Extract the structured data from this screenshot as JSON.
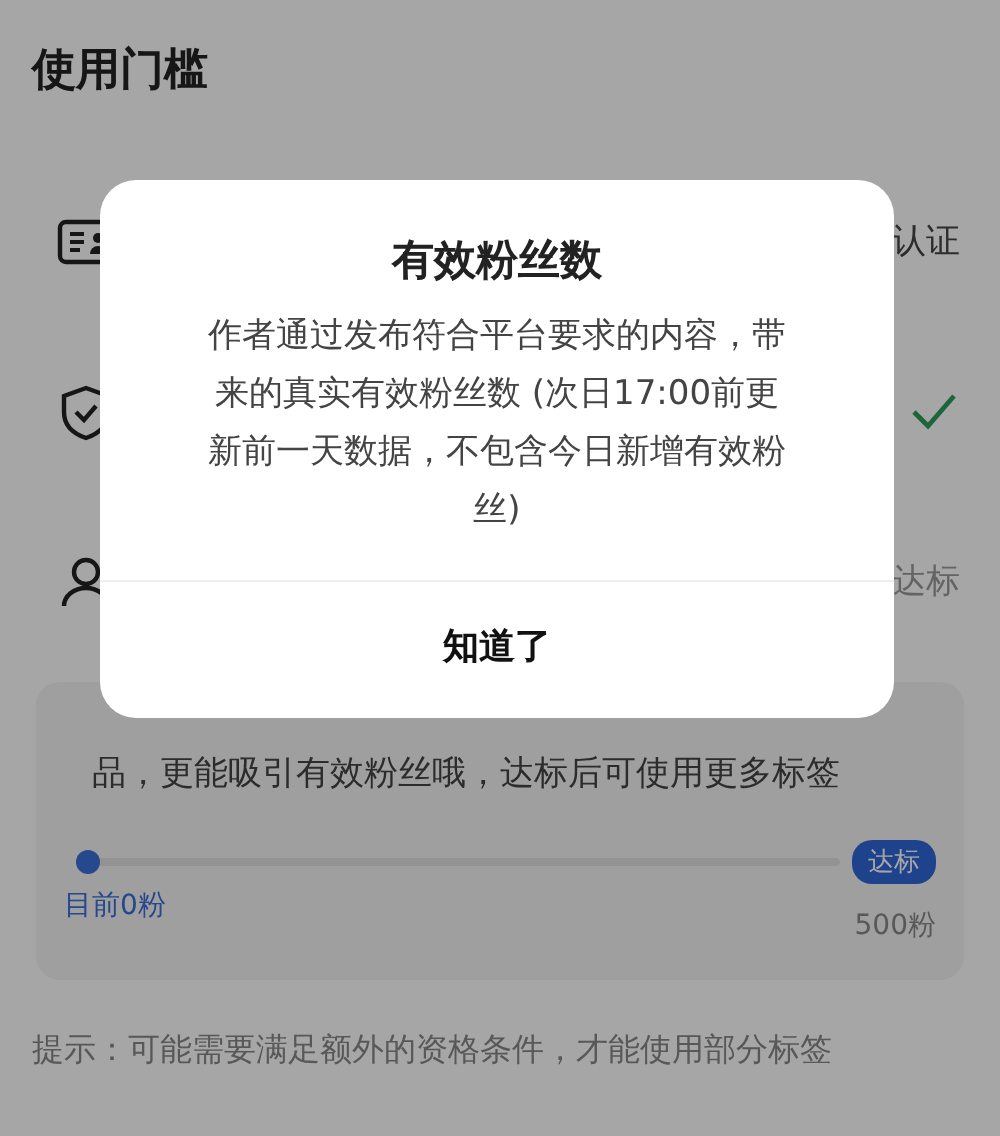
{
  "page": {
    "title": "使用门槛"
  },
  "requirements": [
    {
      "kind": "idcard",
      "checked": false,
      "status": "认证"
    },
    {
      "kind": "shield",
      "checked": true
    },
    {
      "kind": "person",
      "checked": false,
      "status": "达标"
    }
  ],
  "progress_card": {
    "text": "品，更能吸引有效粉丝哦，达标后可使用更多标签",
    "level": 0,
    "target_badge": "达标",
    "current": "目前0粉",
    "target": "500粉"
  },
  "hint": "提示：可能需要满足额外的资格条件，才能使用部分标签",
  "dialog": {
    "title": "有效粉丝数",
    "body": "作者通过发布符合平台要求的内容，带来的真实有效粉丝数 (次日17:00前更新前一天数据，不包含今日新增有效粉丝)",
    "button": "知道了"
  }
}
